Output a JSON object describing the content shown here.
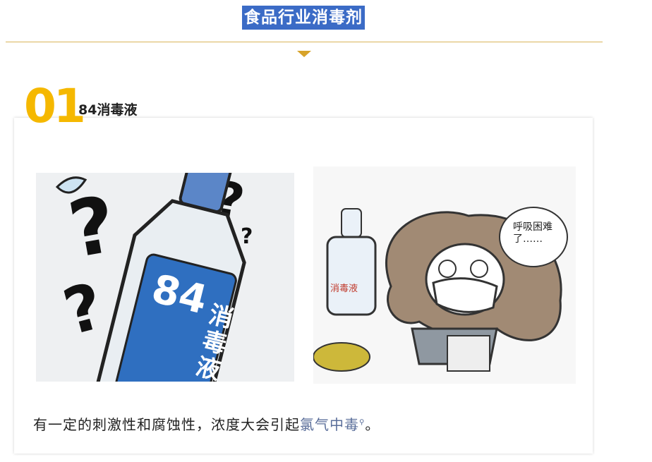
{
  "header": {
    "title": "食品行业消毒剂"
  },
  "section": {
    "number": "01",
    "title": "84消毒液"
  },
  "images": {
    "bottle": {
      "label_number": "84",
      "label_text": "消毒液"
    },
    "cartoon": {
      "bottle_label": "消毒液",
      "speech": "呼吸困难了……"
    }
  },
  "caption": {
    "text_before": "有一定的刺激性和腐蚀性，浓度大会引起",
    "link_text": "氯气中毒",
    "text_after": "。"
  },
  "colors": {
    "title_bg": "#3b6bc6",
    "accent": "#f5b800",
    "divider": "#d9b45a",
    "bottle_blue": "#2f6fc0"
  }
}
